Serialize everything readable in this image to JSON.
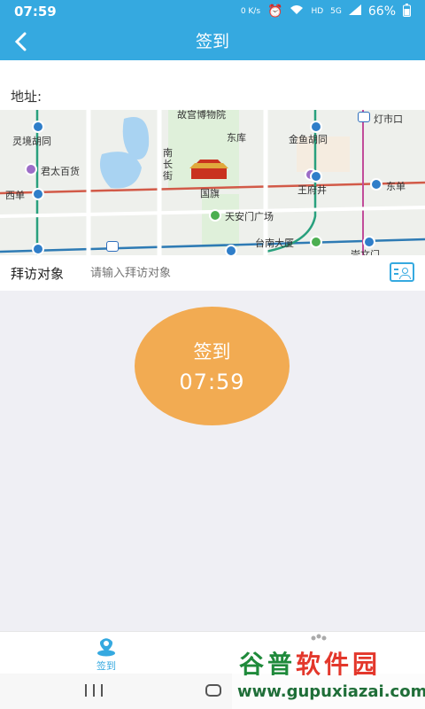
{
  "status_bar": {
    "time": "07:59",
    "net_speed": "0 K/s",
    "network": "5G",
    "hd": "HD",
    "battery": "66%"
  },
  "nav": {
    "back_icon": "chevron-left-icon",
    "title": "签到"
  },
  "address": {
    "label": "地址:"
  },
  "map": {
    "places": [
      "故宫博物院",
      "灯市口",
      "灵境胡同",
      "东库",
      "金鱼胡同",
      "南长街",
      "君太百货",
      "王府井",
      "东单",
      "西单",
      "国旗",
      "天安门广场",
      "台南大厦",
      "崇文门"
    ]
  },
  "visitor": {
    "label": "拜访对象",
    "placeholder": "请输入拜访对象",
    "icon": "id-card-icon"
  },
  "checkin": {
    "label": "签到",
    "time": "07:59"
  },
  "tabbar": {
    "tabs": [
      {
        "label": "签到",
        "icon": "location-pin-icon",
        "active": true
      },
      {
        "label": "",
        "icon": "footprint-icon",
        "active": false
      }
    ]
  },
  "watermark": {
    "brand_a": "谷普",
    "brand_b": "软件园",
    "url": "www.gupuxiazai.com"
  },
  "colors": {
    "primary": "#35a9e0",
    "button": "#f2ab52",
    "background": "#efeff4"
  }
}
